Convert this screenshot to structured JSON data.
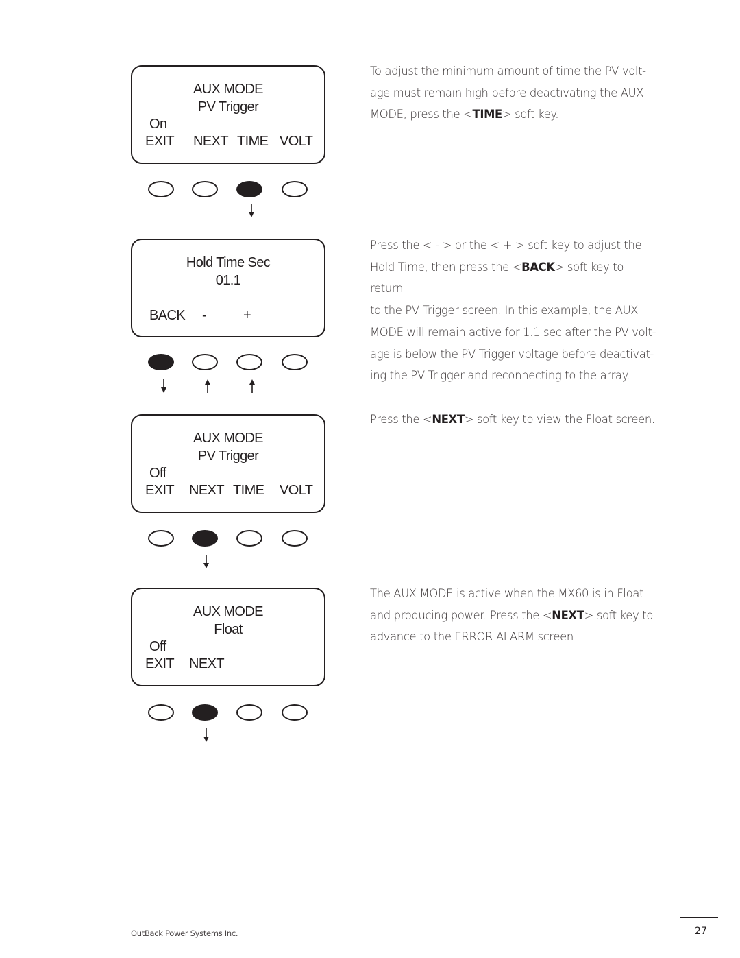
{
  "screens": [
    {
      "title": "AUX MODE",
      "subtitle": "PV Trigger",
      "status": "On",
      "softkeys": [
        "EXIT",
        "NEXT",
        "TIME",
        "VOLT"
      ],
      "pressed_key": 3,
      "arrows": [
        {
          "key": 3,
          "direction": "down"
        }
      ]
    },
    {
      "title": "Hold Time Sec",
      "subtitle": "01.1",
      "status": "",
      "softkeys": [
        "BACK",
        "-",
        "+",
        ""
      ],
      "pressed_key": 1,
      "arrows": [
        {
          "key": 1,
          "direction": "down"
        },
        {
          "key": 2,
          "direction": "up"
        },
        {
          "key": 3,
          "direction": "up"
        }
      ]
    },
    {
      "title": "AUX MODE",
      "subtitle": "PV Trigger",
      "status": "Off",
      "softkeys": [
        "EXIT",
        "NEXT",
        "TIME",
        "VOLT"
      ],
      "pressed_key": 2,
      "arrows": [
        {
          "key": 2,
          "direction": "down"
        }
      ]
    },
    {
      "title": "AUX MODE",
      "subtitle": "Float",
      "status": "Off",
      "softkeys": [
        "EXIT",
        "NEXT",
        "",
        ""
      ],
      "pressed_key": 2,
      "arrows": [
        {
          "key": 2,
          "direction": "down"
        }
      ]
    }
  ],
  "paragraphs": [
    {
      "lines": [
        "To adjust the minimum amount of time the PV volt-",
        "age must remain high before deactivating the AUX",
        "MODE, press the <TIME> soft key."
      ]
    },
    {
      "lines": [
        "Press the < - > or the < + > soft key to adjust the",
        "Hold Time, then press the <BACK> soft key to return",
        "to the PV Trigger screen. In this example, the AUX",
        "MODE will remain active for 1.1 sec after the PV volt-",
        "age is below the PV Trigger voltage before deactivat-",
        "ing the PV Trigger and reconnecting to the array."
      ]
    },
    {
      "lines": [
        "Press the <NEXT> soft key to view the Float screen."
      ]
    },
    {
      "lines": [
        "The AUX MODE is active when the MX60 is in Float",
        "and producing power. Press the <NEXT> soft key to",
        "advance to the ERROR ALARM screen."
      ]
    }
  ],
  "footer": {
    "company": "OutBack Power Systems Inc.",
    "page_number": "27"
  }
}
